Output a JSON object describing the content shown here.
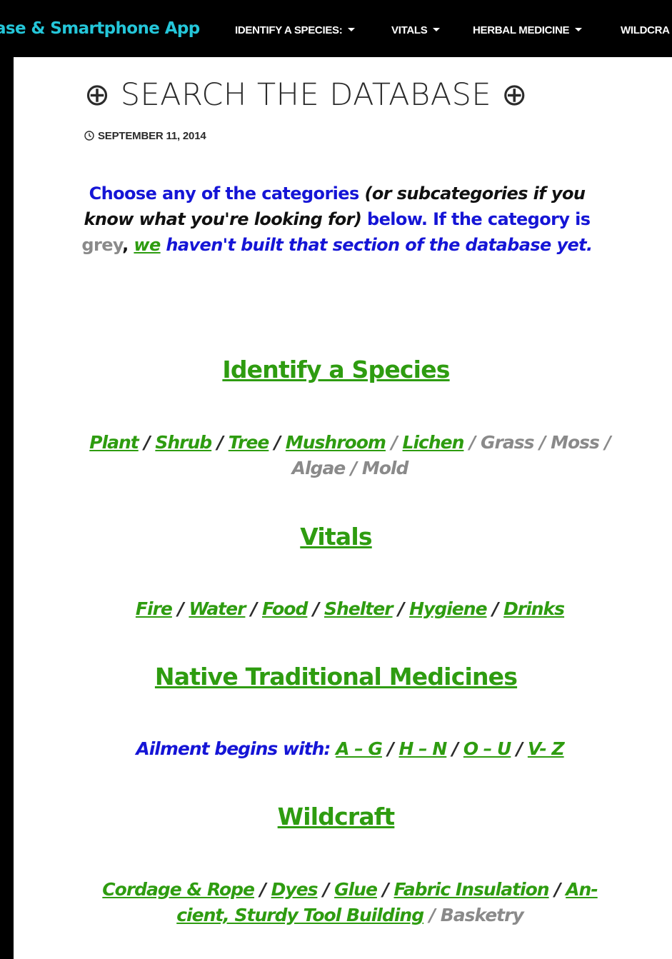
{
  "nav": {
    "brand": "ase & Smartphone App",
    "items": [
      {
        "label": "IDENTIFY A SPECIES:"
      },
      {
        "label": "VITALS"
      },
      {
        "label": "HERBAL MEDICINE"
      },
      {
        "label": "WILDCRA"
      }
    ]
  },
  "post": {
    "title": "⊕ SEARCH THE DATABASE ⊕",
    "date": "SEPTEMBER 11, 2014"
  },
  "intro": {
    "part1": "Choose any of the categories",
    "part2": "(or subcategories if you know what you're looking for)",
    "part3": "below.  If the category is",
    "grey_word": "grey",
    "comma": ",",
    "we": "we",
    "part4": "haven't built that section of the database yet."
  },
  "sections": {
    "identify": {
      "heading": "Identify a Species",
      "links": [
        "Plant",
        "Shrub",
        "Tree",
        "Mushroom",
        "Lichen"
      ],
      "unavailable": [
        "Grass",
        "Moss",
        "Algae",
        "Mold"
      ]
    },
    "vitals": {
      "heading": "Vitals",
      "links": [
        "Fire",
        "Water",
        "Food",
        "Shelter",
        "Hygiene",
        "Drinks"
      ]
    },
    "medicines": {
      "heading": "Native Traditional Medicines",
      "label": "Ailment begins with:",
      "links": [
        "A – G",
        "H – N",
        "O – U",
        "V- Z"
      ]
    },
    "wildcraft": {
      "heading": "Wildcraft",
      "links": [
        "Cordage & Rope",
        "Dyes",
        "Glue",
        "Fabric Insulation",
        "An-",
        "cient, Sturdy Tool Building"
      ],
      "unavailable": [
        "Basketry"
      ]
    }
  },
  "separator": "/",
  "colors": {
    "nav_background": "#000000",
    "brand": "#24c6d9",
    "link_green": "#2e9c10",
    "text_blue": "#1515d6",
    "unavailable_grey": "#8a8a8a"
  }
}
